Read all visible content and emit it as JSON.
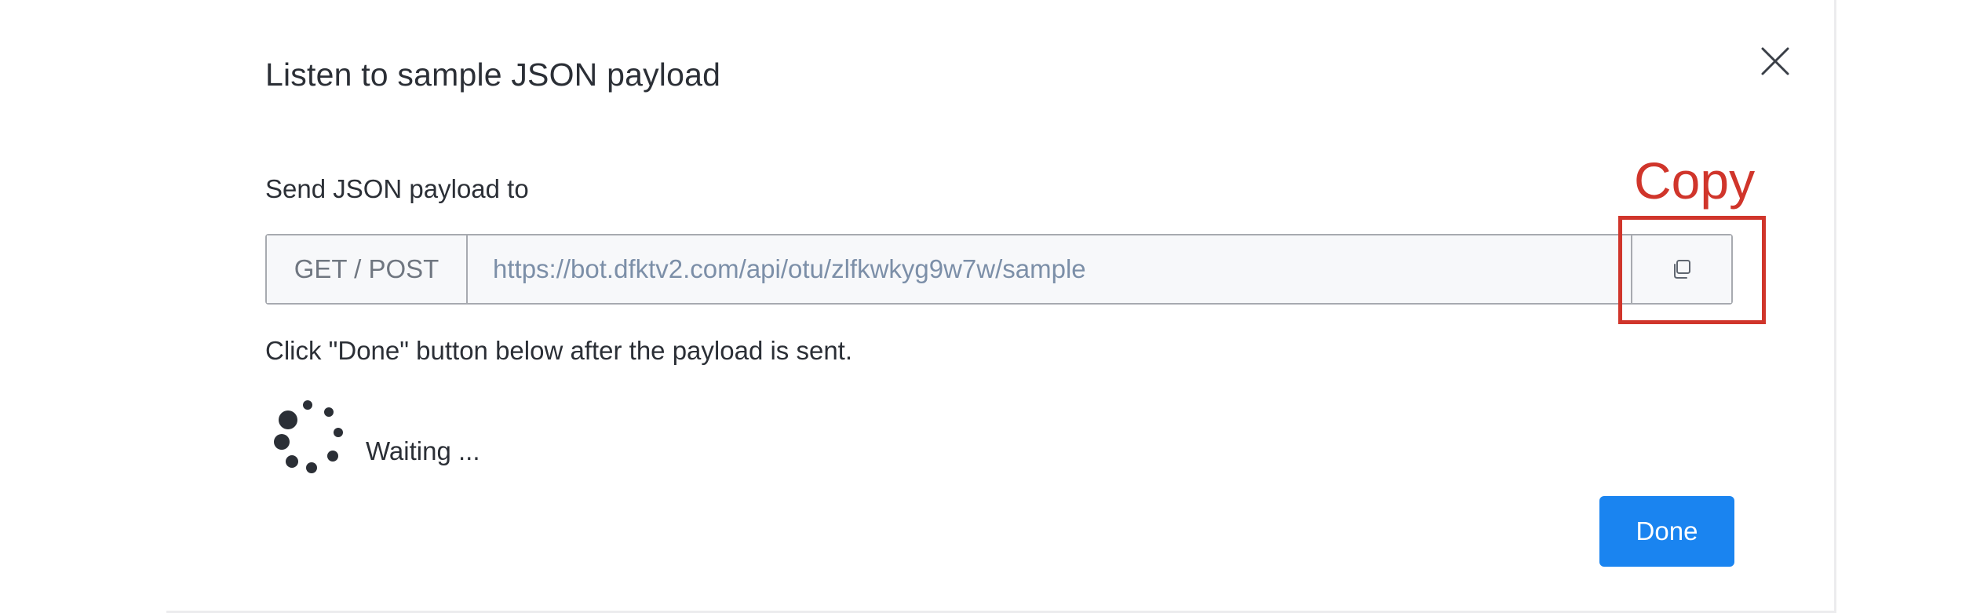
{
  "dialog": {
    "title": "Listen to sample JSON payload",
    "close_icon": "close-icon"
  },
  "endpoint": {
    "label": "Send JSON payload to",
    "method": "GET / POST",
    "url": "https://bot.dfktv2.com/api/otu/zlfkwkyg9w7w/sample",
    "copy_icon": "copy-icon"
  },
  "annotation": {
    "label": "Copy",
    "color": "#d0352b"
  },
  "instructions": {
    "hint": "Click \"Done\" button below after the payload is sent."
  },
  "status": {
    "icon": "loading-spinner-icon",
    "text": "Waiting ..."
  },
  "actions": {
    "done_label": "Done",
    "done_color": "#1a84f0"
  }
}
